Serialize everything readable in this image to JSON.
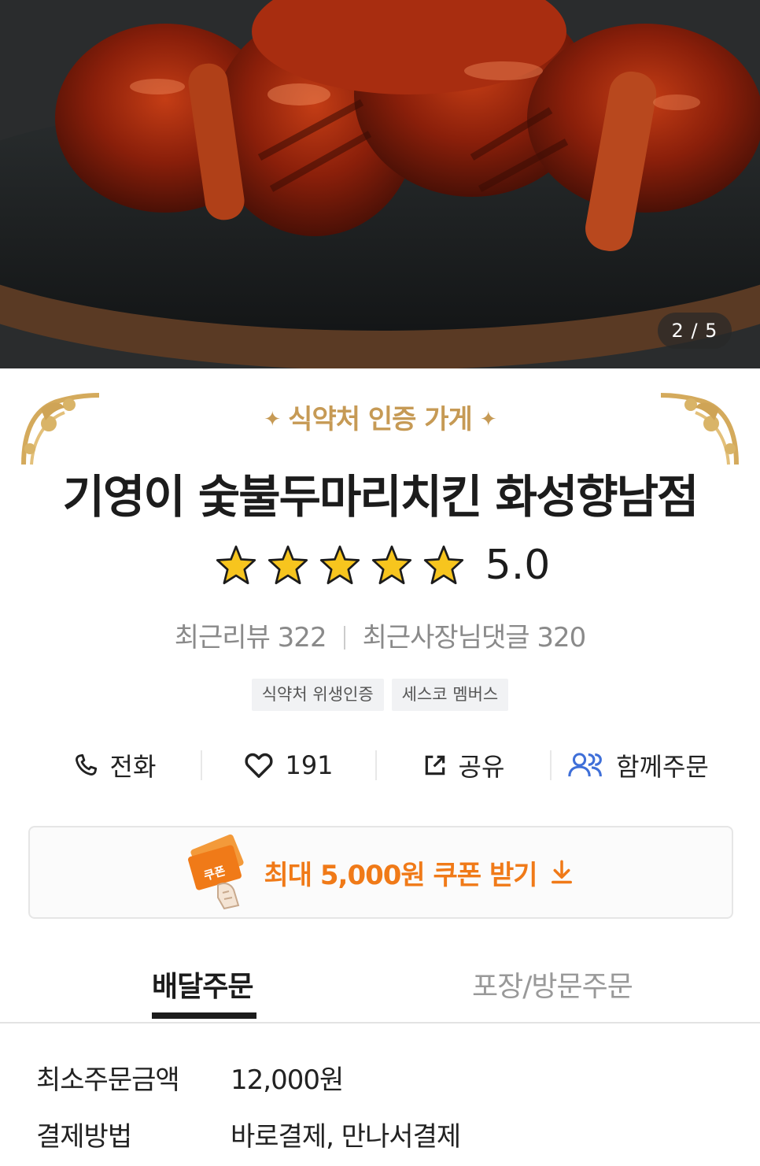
{
  "hero": {
    "pager_text": "2 / 5"
  },
  "header": {
    "certification_label": "식약처 인증 가게",
    "store_name": "기영이 숯불두마리치킨 화성향남점",
    "rating": {
      "stars": 5,
      "score": "5.0"
    },
    "recent_reviews": "최근리뷰 322",
    "owner_replies": "최근사장님댓글 320",
    "badges": [
      "식약처 위생인증",
      "세스코 멤버스"
    ]
  },
  "actions": {
    "call_label": "전화",
    "like_count": "191",
    "share_label": "공유",
    "group_order_label": "함께주문"
  },
  "coupon": {
    "icon_text": "쿠폰",
    "label": "최대 5,000원 쿠폰 받기"
  },
  "tabs": [
    {
      "label": "배달주문",
      "active": true
    },
    {
      "label": "포장/방문주문",
      "active": false
    }
  ],
  "info": [
    {
      "key": "최소주문금액",
      "value": "12,000원"
    },
    {
      "key": "결제방법",
      "value": "바로결제, 만나서결제"
    }
  ],
  "colors": {
    "accent_orange": "#f07a18",
    "gold": "#c69a55",
    "star_yellow": "#f7c51e",
    "group_order_blue": "#3f6fd8"
  }
}
